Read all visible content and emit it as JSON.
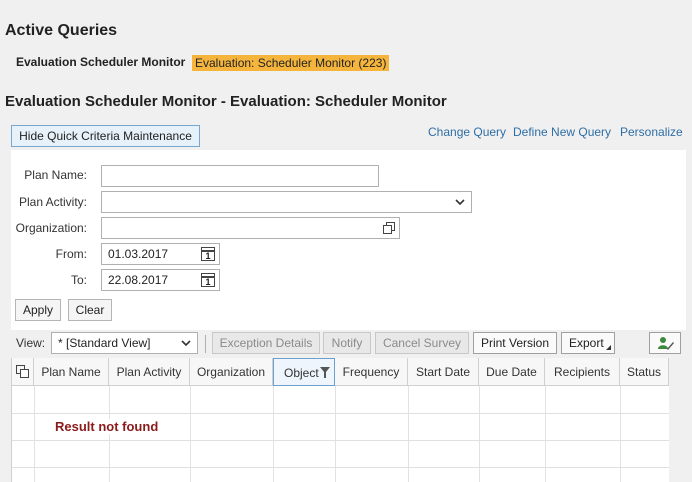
{
  "page": {
    "title": "Active Queries",
    "section_title": "Evaluation Scheduler Monitor - Evaluation: Scheduler Monitor"
  },
  "query_list": {
    "label": "Evaluation Scheduler Monitor",
    "active_tag": "Evaluation: Scheduler Monitor (223)"
  },
  "actions": {
    "hide_criteria": "Hide Quick Criteria Maintenance",
    "change_query": "Change Query",
    "define_new_query": "Define New Query",
    "personalize": "Personalize"
  },
  "criteria": {
    "plan_name_label": "Plan Name:",
    "plan_name_value": "",
    "plan_activity_label": "Plan Activity:",
    "plan_activity_value": "",
    "organization_label": "Organization:",
    "organization_value": "",
    "from_label": "From:",
    "from_value": "01.03.2017",
    "to_label": "To:",
    "to_value": "22.08.2017",
    "apply": "Apply",
    "clear": "Clear"
  },
  "toolbar": {
    "view_label": "View:",
    "view_value": "* [Standard View]",
    "exception_details": "Exception Details",
    "notify": "Notify",
    "cancel_survey": "Cancel Survey",
    "print_version": "Print Version",
    "export": "Export"
  },
  "table": {
    "columns": [
      "Plan Name",
      "Plan Activity",
      "Organization",
      "Object",
      "Frequency",
      "Start Date",
      "Due Date",
      "Recipients",
      "Status"
    ],
    "empty_message": "Result not found"
  },
  "colors": {
    "link": "#2f6ea5",
    "tag": "#f5b53d",
    "message": "#8b1a1a"
  },
  "icons": [
    "calendar-icon",
    "value-help-icon",
    "chevron-down-icon",
    "settings-person-icon",
    "table-settings-icon",
    "filter-icon"
  ]
}
